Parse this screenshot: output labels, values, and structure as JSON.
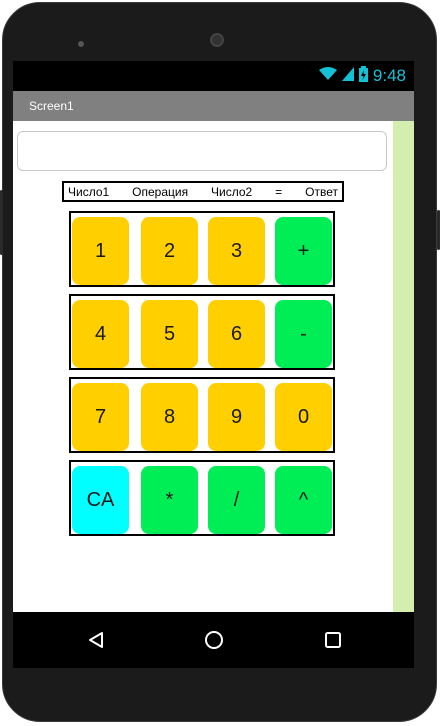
{
  "status": {
    "time": "9:48",
    "wifi_icon": "wifi-icon",
    "signal_icon": "signal-icon",
    "battery_icon": "battery-charging-icon",
    "accent": "#15c1d6"
  },
  "title": {
    "text": "Screen1"
  },
  "input": {
    "value": "",
    "placeholder": ""
  },
  "header": {
    "number1": "Число1",
    "operation": "Операция",
    "number2": "Число2",
    "equals": "=",
    "answer": "Ответ"
  },
  "keypad": {
    "rows": [
      [
        "1",
        "2",
        "3",
        "+"
      ],
      [
        "4",
        "5",
        "6",
        "-"
      ],
      [
        "7",
        "8",
        "9",
        "0"
      ],
      [
        "CA",
        "*",
        "/",
        "^"
      ]
    ],
    "colors": {
      "digit": "#ffcf00",
      "operator": "#00ee55",
      "clear": "#00ffff"
    }
  },
  "navbar": {
    "back_icon": "back-triangle-icon",
    "home_icon": "home-circle-icon",
    "recents_icon": "recents-square-icon"
  }
}
